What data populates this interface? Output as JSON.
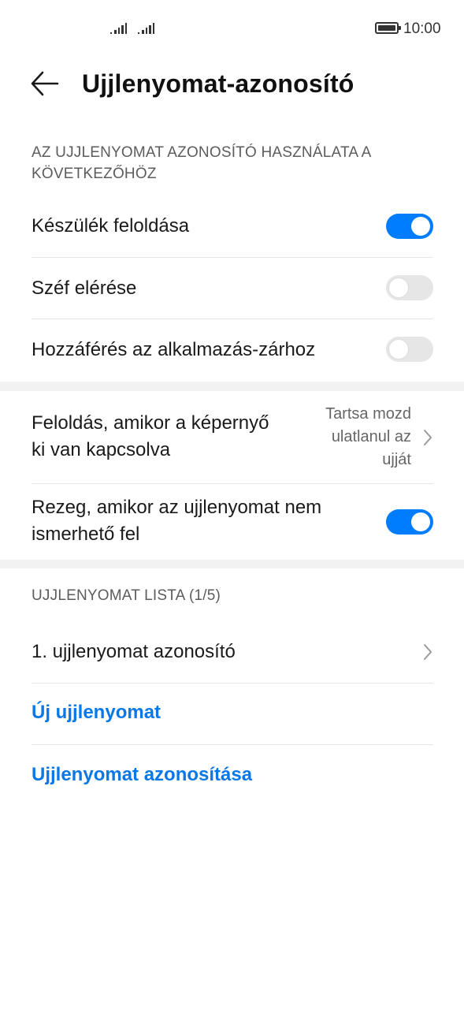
{
  "status_bar": {
    "time": "10:00"
  },
  "header": {
    "title": "Ujjlenyomat-azonosító"
  },
  "usage_section": {
    "label_line1": "AZ UJJLENYOMAT AZONOSÍTÓ HASZNÁLATA A",
    "label_line2": "KÖVETKEZŐHÖZ",
    "items": [
      {
        "label": "Készülék feloldása",
        "enabled": true
      },
      {
        "label": "Széf elérése",
        "enabled": false
      },
      {
        "label": "Hozzáférés az alkalmazás-zárhoz",
        "enabled": false
      }
    ]
  },
  "unlock_screen_off": {
    "label_line1": "Feloldás, amikor a képernyő",
    "label_line2": "ki van kapcsolva",
    "value_line1": "Tartsa mozd",
    "value_line2": "ulatlanul az",
    "value_line3": "ujját"
  },
  "vibrate": {
    "label_line1": "Rezeg, amikor az ujjlenyomat nem",
    "label_line2": "ismerhető fel",
    "enabled": true
  },
  "list_section": {
    "label": "UJJLENYOMAT LISTA (1/5)",
    "fingerprints": [
      "1. ujjlenyomat azonosító"
    ],
    "new_label": "Új ujjlenyomat",
    "identify_label": "Ujjlenyomat azonosítása"
  },
  "colors": {
    "accent": "#007dff",
    "link": "#0a78e6",
    "toggle_off": "#e6e6e6"
  }
}
